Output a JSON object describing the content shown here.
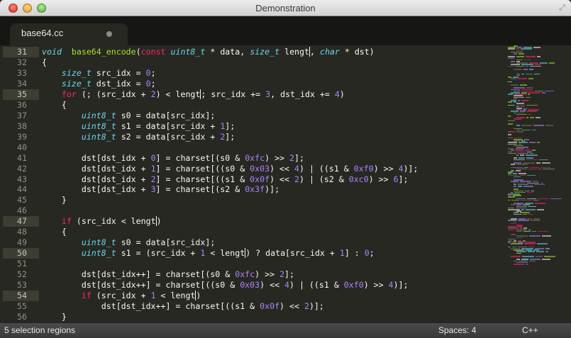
{
  "window": {
    "title": "Demonstration"
  },
  "tab": {
    "label": "base64.cc"
  },
  "status": {
    "selection": "5 selection regions",
    "indent": "Spaces: 4",
    "syntax": "C++"
  },
  "colors": {
    "background": "#272822",
    "keyword": "#f92672",
    "type": "#66d9ef",
    "function": "#a6e22e",
    "number": "#ae81ff",
    "text": "#f8f8f2"
  },
  "editor": {
    "lines": [
      {
        "num": "31",
        "hl": true,
        "tokens": [
          [
            "t",
            "void"
          ],
          [
            "",
            "  "
          ],
          [
            "f",
            "base64_encode"
          ],
          [
            "",
            "("
          ],
          [
            "k",
            "const"
          ],
          [
            "",
            " "
          ],
          [
            "t",
            "uint8_t"
          ],
          [
            "",
            " * data, "
          ],
          [
            "t",
            "size_t"
          ],
          [
            "",
            " lengt"
          ],
          [
            "c",
            ""
          ],
          [
            "",
            ", "
          ],
          [
            "t",
            "char"
          ],
          [
            "",
            " * dst)"
          ]
        ]
      },
      {
        "num": "32",
        "tokens": [
          [
            "",
            "{"
          ]
        ]
      },
      {
        "num": "33",
        "tokens": [
          [
            "",
            "    "
          ],
          [
            "t",
            "size_t"
          ],
          [
            "",
            " src_idx = "
          ],
          [
            "n",
            "0"
          ],
          [
            "",
            ";"
          ]
        ]
      },
      {
        "num": "34",
        "tokens": [
          [
            "",
            "    "
          ],
          [
            "t",
            "size_t"
          ],
          [
            "",
            " dst_idx = "
          ],
          [
            "n",
            "0"
          ],
          [
            "",
            ";"
          ]
        ]
      },
      {
        "num": "35",
        "hl": true,
        "tokens": [
          [
            "",
            "    "
          ],
          [
            "k",
            "for"
          ],
          [
            "",
            " (; (src_idx + "
          ],
          [
            "n",
            "2"
          ],
          [
            "",
            ") < lengt"
          ],
          [
            "c",
            ""
          ],
          [
            "",
            "; src_idx += "
          ],
          [
            "n",
            "3"
          ],
          [
            "",
            ", dst_idx += "
          ],
          [
            "n",
            "4"
          ],
          [
            "",
            ")"
          ]
        ]
      },
      {
        "num": "36",
        "tokens": [
          [
            "",
            "    {"
          ]
        ]
      },
      {
        "num": "37",
        "tokens": [
          [
            "",
            "        "
          ],
          [
            "t",
            "uint8_t"
          ],
          [
            "",
            " s0 = data[src_idx];"
          ]
        ]
      },
      {
        "num": "38",
        "tokens": [
          [
            "",
            "        "
          ],
          [
            "t",
            "uint8_t"
          ],
          [
            "",
            " s1 = data[src_idx + "
          ],
          [
            "n",
            "1"
          ],
          [
            "",
            "];"
          ]
        ]
      },
      {
        "num": "39",
        "tokens": [
          [
            "",
            "        "
          ],
          [
            "t",
            "uint8_t"
          ],
          [
            "",
            " s2 = data[src_idx + "
          ],
          [
            "n",
            "2"
          ],
          [
            "",
            "];"
          ]
        ]
      },
      {
        "num": "40",
        "tokens": []
      },
      {
        "num": "41",
        "tokens": [
          [
            "",
            "        dst[dst_idx + "
          ],
          [
            "n",
            "0"
          ],
          [
            "",
            "] = charset[(s0 & "
          ],
          [
            "n",
            "0xfc"
          ],
          [
            "",
            ") >> "
          ],
          [
            "n",
            "2"
          ],
          [
            "",
            "];"
          ]
        ]
      },
      {
        "num": "42",
        "tokens": [
          [
            "",
            "        dst[dst_idx + "
          ],
          [
            "n",
            "1"
          ],
          [
            "",
            "] = charset[((s0 & "
          ],
          [
            "n",
            "0x03"
          ],
          [
            "",
            ") << "
          ],
          [
            "n",
            "4"
          ],
          [
            "",
            ") | ((s1 & "
          ],
          [
            "n",
            "0xf0"
          ],
          [
            "",
            ") >> "
          ],
          [
            "n",
            "4"
          ],
          [
            "",
            ")];"
          ]
        ]
      },
      {
        "num": "43",
        "tokens": [
          [
            "",
            "        dst[dst_idx + "
          ],
          [
            "n",
            "2"
          ],
          [
            "",
            "] = charset[((s1 & "
          ],
          [
            "n",
            "0x0f"
          ],
          [
            "",
            ") << "
          ],
          [
            "n",
            "2"
          ],
          [
            "",
            ") | (s2 & "
          ],
          [
            "n",
            "0xc0"
          ],
          [
            "",
            ") >> "
          ],
          [
            "n",
            "6"
          ],
          [
            "",
            "];"
          ]
        ]
      },
      {
        "num": "44",
        "tokens": [
          [
            "",
            "        dst[dst_idx + "
          ],
          [
            "n",
            "3"
          ],
          [
            "",
            "] = charset[(s2 & "
          ],
          [
            "n",
            "0x3f"
          ],
          [
            "",
            ")];"
          ]
        ]
      },
      {
        "num": "45",
        "tokens": [
          [
            "",
            "    }"
          ]
        ]
      },
      {
        "num": "46",
        "tokens": []
      },
      {
        "num": "47",
        "hl": true,
        "tokens": [
          [
            "",
            "    "
          ],
          [
            "k",
            "if"
          ],
          [
            "",
            " (src_idx < lengt"
          ],
          [
            "c",
            ""
          ],
          [
            "",
            ")"
          ]
        ]
      },
      {
        "num": "48",
        "tokens": [
          [
            "",
            "    {"
          ]
        ]
      },
      {
        "num": "49",
        "tokens": [
          [
            "",
            "        "
          ],
          [
            "t",
            "uint8_t"
          ],
          [
            "",
            " s0 = data[src_idx];"
          ]
        ]
      },
      {
        "num": "50",
        "hl": true,
        "tokens": [
          [
            "",
            "        "
          ],
          [
            "t",
            "uint8_t"
          ],
          [
            "",
            " s1 = (src_idx + "
          ],
          [
            "n",
            "1"
          ],
          [
            "",
            " < lengt"
          ],
          [
            "c",
            ""
          ],
          [
            "",
            ") ? data[src_idx + "
          ],
          [
            "n",
            "1"
          ],
          [
            "",
            "] : "
          ],
          [
            "n",
            "0"
          ],
          [
            "",
            ";"
          ]
        ]
      },
      {
        "num": "51",
        "tokens": []
      },
      {
        "num": "52",
        "tokens": [
          [
            "",
            "        dst[dst_idx++] = charset[(s0 & "
          ],
          [
            "n",
            "0xfc"
          ],
          [
            "",
            ") >> "
          ],
          [
            "n",
            "2"
          ],
          [
            "",
            "];"
          ]
        ]
      },
      {
        "num": "53",
        "tokens": [
          [
            "",
            "        dst[dst_idx++] = charset[((s0 & "
          ],
          [
            "n",
            "0x03"
          ],
          [
            "",
            ") << "
          ],
          [
            "n",
            "4"
          ],
          [
            "",
            ") | ((s1 & "
          ],
          [
            "n",
            "0xf0"
          ],
          [
            "",
            ") >> "
          ],
          [
            "n",
            "4"
          ],
          [
            "",
            ")];"
          ]
        ]
      },
      {
        "num": "54",
        "hl": true,
        "tokens": [
          [
            "",
            "        "
          ],
          [
            "k",
            "if"
          ],
          [
            "",
            " (src_idx + "
          ],
          [
            "n",
            "1"
          ],
          [
            "",
            " < lengt"
          ],
          [
            "c",
            ""
          ],
          [
            "",
            ")"
          ]
        ]
      },
      {
        "num": "55",
        "tokens": [
          [
            "",
            "            dst[dst_idx++] = charset[((s1 & "
          ],
          [
            "n",
            "0x0f"
          ],
          [
            "",
            ") << "
          ],
          [
            "n",
            "2"
          ],
          [
            "",
            ")];"
          ]
        ]
      },
      {
        "num": "56",
        "tokens": [
          [
            "",
            "    }"
          ]
        ]
      }
    ]
  }
}
